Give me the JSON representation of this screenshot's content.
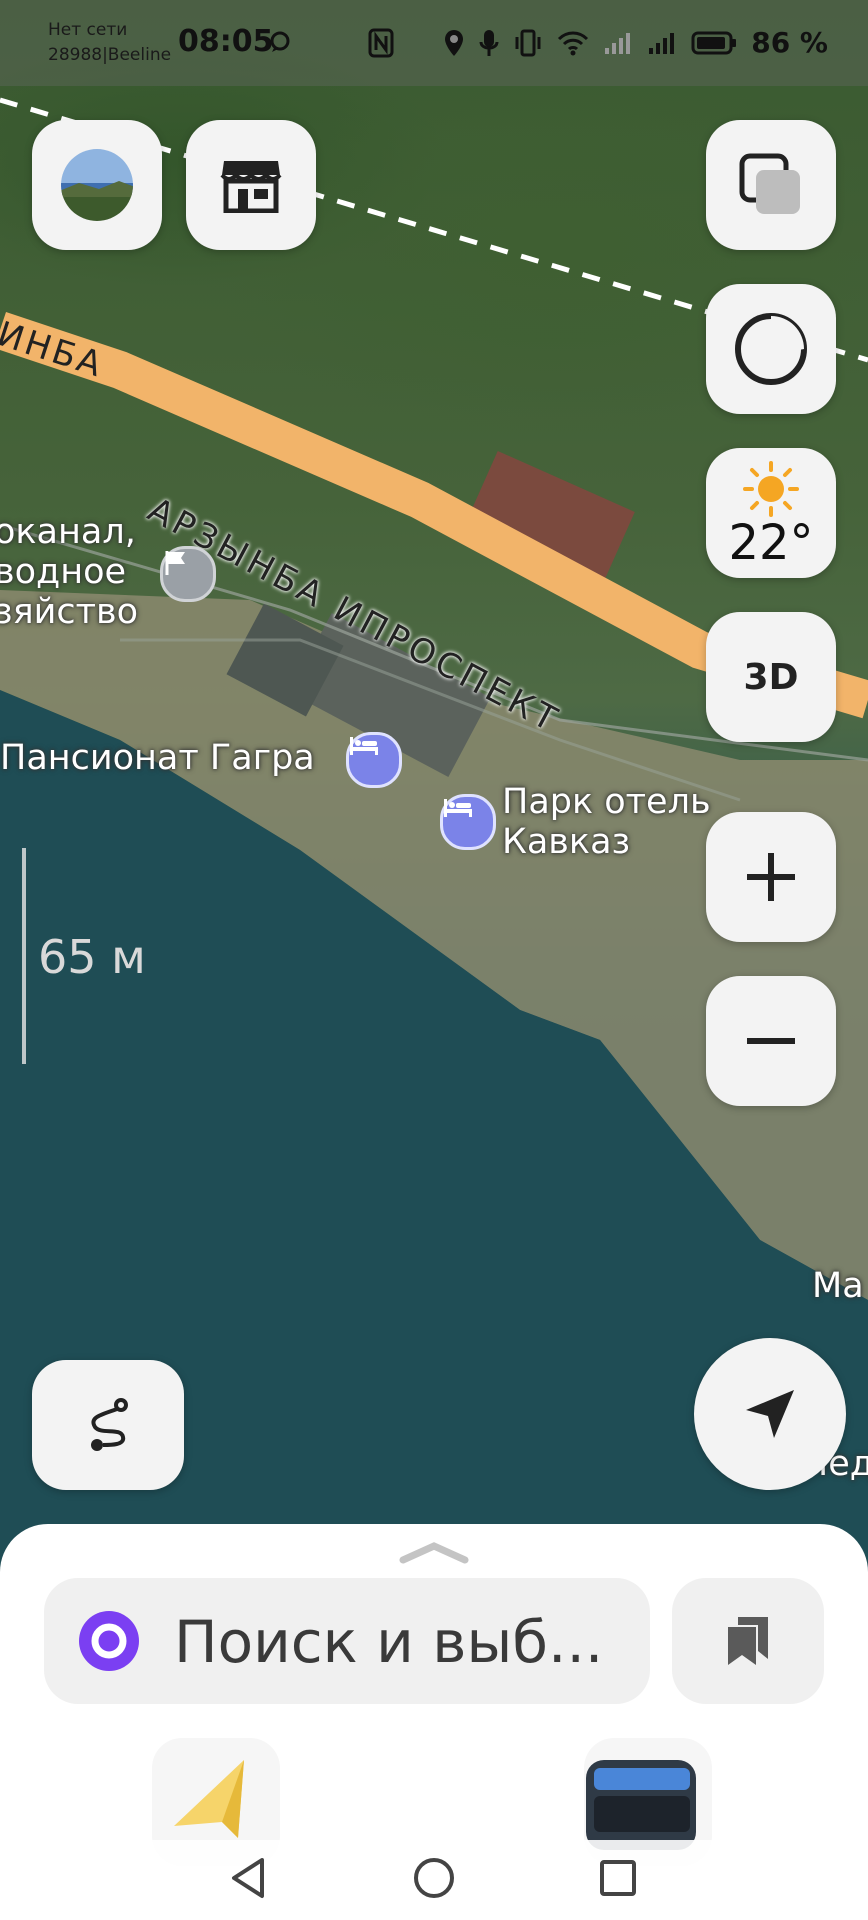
{
  "status_bar": {
    "carrier_line1": "Нет сети",
    "carrier_line2": "28988|Beeline",
    "time": "08:05",
    "battery": "86 %"
  },
  "map": {
    "road_label_main": "АРЗЫНБА ИПРОСПЕКТ",
    "road_label_left": "ИНБА",
    "poi_left_line1": "оканал,",
    "poi_left_line2": "водное",
    "poi_left_line3": "зяйство",
    "poi_pension": "Пансионат Гагра",
    "poi_park_line1": "Парк отель",
    "poi_park_line2": "Кавказ",
    "edge_label_1": "Ма",
    "edge_label_2": "Мед",
    "scale": "65 м"
  },
  "controls": {
    "weather_temp": "22°",
    "btn_3d": "3D"
  },
  "search": {
    "placeholder": "Поиск и выб..."
  },
  "colors": {
    "road": "#f2b46a",
    "alice_purple": "#7b3ff2",
    "poi": "#7b83e8"
  }
}
